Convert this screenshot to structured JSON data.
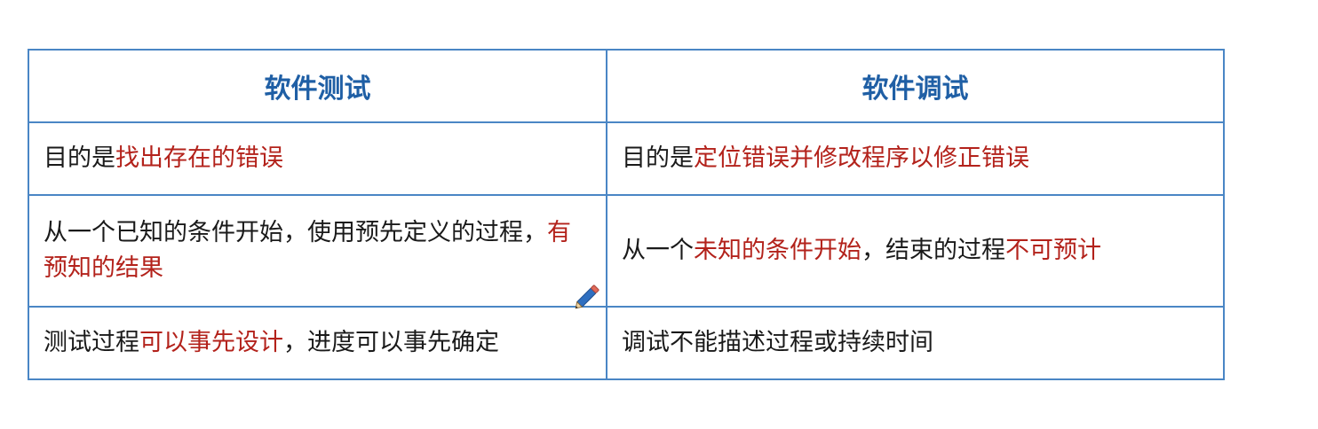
{
  "table": {
    "headers": [
      "软件测试",
      "软件调试"
    ],
    "rows": [
      {
        "left": [
          {
            "text": "目的是",
            "emphasis": false
          },
          {
            "text": "找出存在的错误",
            "emphasis": true
          }
        ],
        "right": [
          {
            "text": "目的是",
            "emphasis": false
          },
          {
            "text": "定位错误并修改程序以修正错误",
            "emphasis": true
          }
        ]
      },
      {
        "left": [
          {
            "text": "从一个已知的条件开始，使用预先定义的过程，",
            "emphasis": false
          },
          {
            "text": "有预知的结果",
            "emphasis": true
          }
        ],
        "right": [
          {
            "text": "从一个",
            "emphasis": false
          },
          {
            "text": "未知的条件开始",
            "emphasis": true
          },
          {
            "text": "，结束的过程",
            "emphasis": false
          },
          {
            "text": "不可预计",
            "emphasis": true
          }
        ]
      },
      {
        "left": [
          {
            "text": "测试过程",
            "emphasis": false
          },
          {
            "text": "可以事先设计",
            "emphasis": true
          },
          {
            "text": "，进度可以事先确定",
            "emphasis": false
          }
        ],
        "right": [
          {
            "text": "调试不能描述过程或持续时间",
            "emphasis": false
          }
        ]
      }
    ]
  },
  "colors": {
    "border": "#4a86c5",
    "header_text": "#1f5fa5",
    "emphasis_text": "#b3221b",
    "body_text": "#1a1a1a"
  },
  "icons": {
    "annotation": "pencil-icon"
  }
}
